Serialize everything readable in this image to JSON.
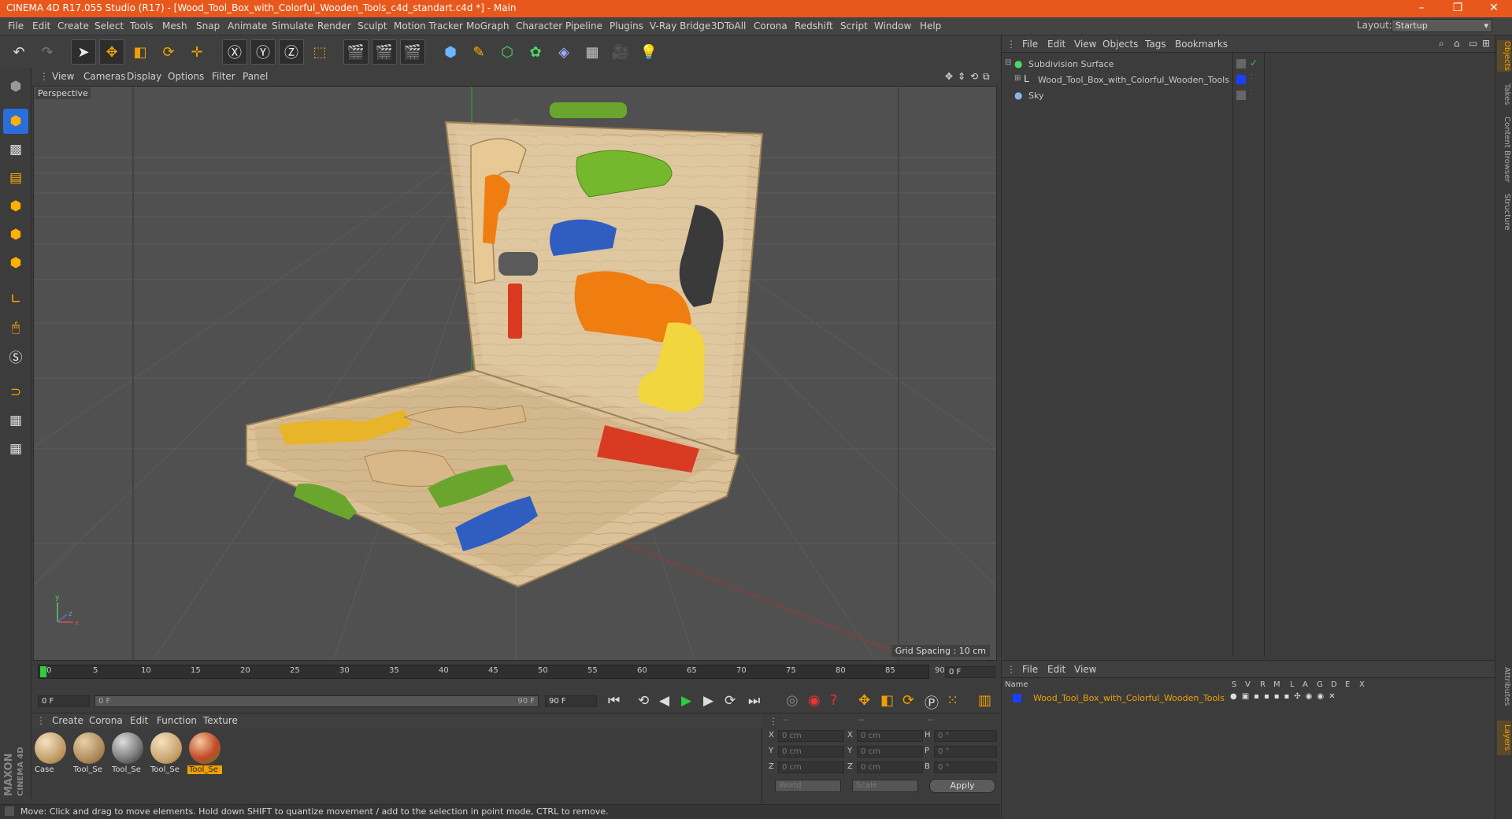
{
  "window": {
    "title": "CINEMA 4D R17.055 Studio (R17) - [Wood_Tool_Box_with_Colorful_Wooden_Tools_c4d_standart.c4d *] - Main",
    "minimize": "–",
    "maximize": "❐",
    "close": "✕"
  },
  "menubar": {
    "items": [
      "File",
      "Edit",
      "Create",
      "Select",
      "Tools",
      "Mesh",
      "Snap",
      "Animate",
      "Simulate",
      "Render",
      "Sculpt",
      "Motion Tracker",
      "MoGraph",
      "Character",
      "Pipeline",
      "Plugins",
      "V-Ray Bridge",
      "3DToAll",
      "Corona",
      "Redshift",
      "Script",
      "Window",
      "Help"
    ],
    "layout_label": "Layout:",
    "layout_value": "Startup"
  },
  "viewport": {
    "menu": [
      "View",
      "Cameras",
      "Display",
      "Options",
      "Filter",
      "Panel"
    ],
    "label": "Perspective",
    "grid_spacing": "Grid Spacing : 10 cm"
  },
  "timeline": {
    "ticks": [
      "0",
      "5",
      "10",
      "15",
      "20",
      "25",
      "30",
      "35",
      "40",
      "45",
      "50",
      "55",
      "60",
      "65",
      "70",
      "75",
      "80",
      "85",
      "90"
    ],
    "frame_display": "0 F"
  },
  "playbar": {
    "start": "0 F",
    "range_start": "0 F",
    "range_end": "90 F",
    "end": "90 F"
  },
  "materials": {
    "menu": [
      "Create",
      "Corona",
      "Edit",
      "Function",
      "Texture"
    ],
    "items": [
      {
        "label": "Case"
      },
      {
        "label": "Tool_Se"
      },
      {
        "label": "Tool_Se"
      },
      {
        "label": "Tool_Se"
      },
      {
        "label": "Tool_Se"
      }
    ]
  },
  "coords": {
    "header": [
      "--",
      "--",
      "--"
    ],
    "rows": [
      {
        "a": "X",
        "av": "0 cm",
        "b": "X",
        "bv": "0 cm",
        "c": "H",
        "cv": "0 °"
      },
      {
        "a": "Y",
        "av": "0 cm",
        "b": "Y",
        "bv": "0 cm",
        "c": "P",
        "cv": "0 °"
      },
      {
        "a": "Z",
        "av": "0 cm",
        "b": "Z",
        "bv": "0 cm",
        "c": "B",
        "cv": "0 °"
      }
    ],
    "world": "World",
    "scale": "Scale",
    "apply": "Apply"
  },
  "objects": {
    "menu": [
      "File",
      "Edit",
      "View",
      "Objects",
      "Tags",
      "Bookmarks"
    ],
    "items": [
      {
        "name": "Subdivision Surface"
      },
      {
        "name": "Wood_Tool_Box_with_Colorful_Wooden_Tools"
      },
      {
        "name": "Sky"
      }
    ]
  },
  "layers": {
    "menu": [
      "File",
      "Edit",
      "View"
    ],
    "col_name": "Name",
    "col_flags": [
      "S",
      "V",
      "R",
      "M",
      "L",
      "A",
      "G",
      "D",
      "E",
      "X"
    ],
    "row": "Wood_Tool_Box_with_Colorful_Wooden_Tools"
  },
  "right_tabs": [
    "Objects",
    "Takes",
    "Content Browser",
    "Structure",
    "Attributes",
    "Layers"
  ],
  "status": "Move: Click and drag to move elements. Hold down SHIFT to quantize movement / add to the selection in point mode, CTRL to remove.",
  "logo": {
    "brand": "MAXON",
    "product": "CINEMA 4D"
  },
  "colors": {
    "title_bar": "#e8581c",
    "accent_blue": "#2a6edb",
    "highlight": "#f0a000"
  }
}
